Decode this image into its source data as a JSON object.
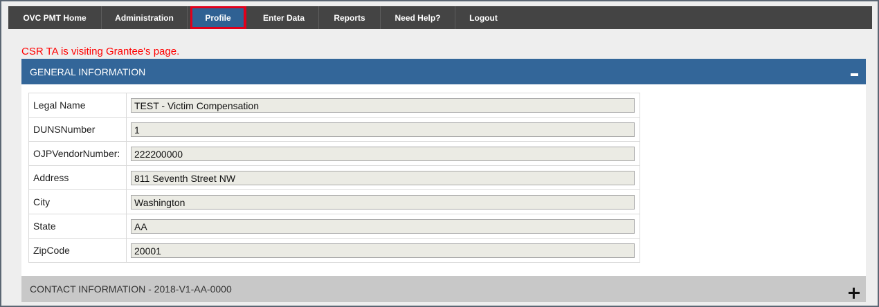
{
  "nav": {
    "items": [
      {
        "label": "OVC PMT Home"
      },
      {
        "label": "Administration"
      },
      {
        "label": "Profile"
      },
      {
        "label": "Enter Data"
      },
      {
        "label": "Reports"
      },
      {
        "label": "Need Help?"
      },
      {
        "label": "Logout"
      }
    ],
    "active": "Profile"
  },
  "visit_message": "CSR TA is visiting Grantee's page.",
  "general_info": {
    "title": "GENERAL INFORMATION",
    "fields": [
      {
        "label": "Legal Name",
        "value": "TEST - Victim Compensation"
      },
      {
        "label": "DUNSNumber",
        "value": "1"
      },
      {
        "label": "OJPVendorNumber:",
        "value": "222200000"
      },
      {
        "label": "Address",
        "value": "811 Seventh Street NW"
      },
      {
        "label": "City",
        "value": "Washington"
      },
      {
        "label": "State",
        "value": "AA"
      },
      {
        "label": "ZipCode",
        "value": "20001"
      }
    ]
  },
  "contact_info": {
    "title": "CONTACT INFORMATION - 2018-V1-AA-0000"
  },
  "colors": {
    "nav_bg": "#444444",
    "active_tab": "#2f6193",
    "highlight_border": "#e0001b",
    "section_header": "#336699",
    "alert_text": "#ff0000"
  }
}
